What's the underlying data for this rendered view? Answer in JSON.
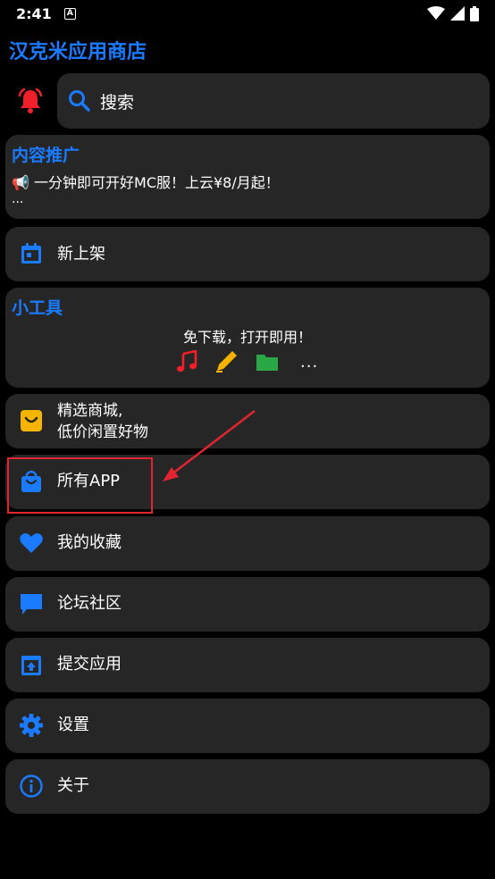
{
  "status_bar": {
    "time": "2:41",
    "notification_glyph": "A"
  },
  "app": {
    "title": "汉克米应用商店",
    "accent_color": "#1a7bff"
  },
  "search": {
    "label": "搜索"
  },
  "promo": {
    "title": "内容推广",
    "text": "📢 一分钟即可开好MC服！上云¥8/月起！",
    "more": "..."
  },
  "menu": {
    "new_arrivals": "新上架",
    "mall_line1": "精选商城,",
    "mall_line2": "低价闲置好物",
    "all_apps": "所有APP",
    "favorites": "我的收藏",
    "forum": "论坛社区",
    "submit": "提交应用",
    "settings": "设置",
    "about": "关于"
  },
  "tools": {
    "title": "小工具",
    "subtitle": "免下载，打开即用！",
    "more": "...",
    "icons": [
      "music-note-icon",
      "pencil-icon",
      "folder-icon"
    ]
  },
  "annotation": {
    "color": "#e22430",
    "icons": [
      "highlight-box",
      "arrow"
    ]
  }
}
